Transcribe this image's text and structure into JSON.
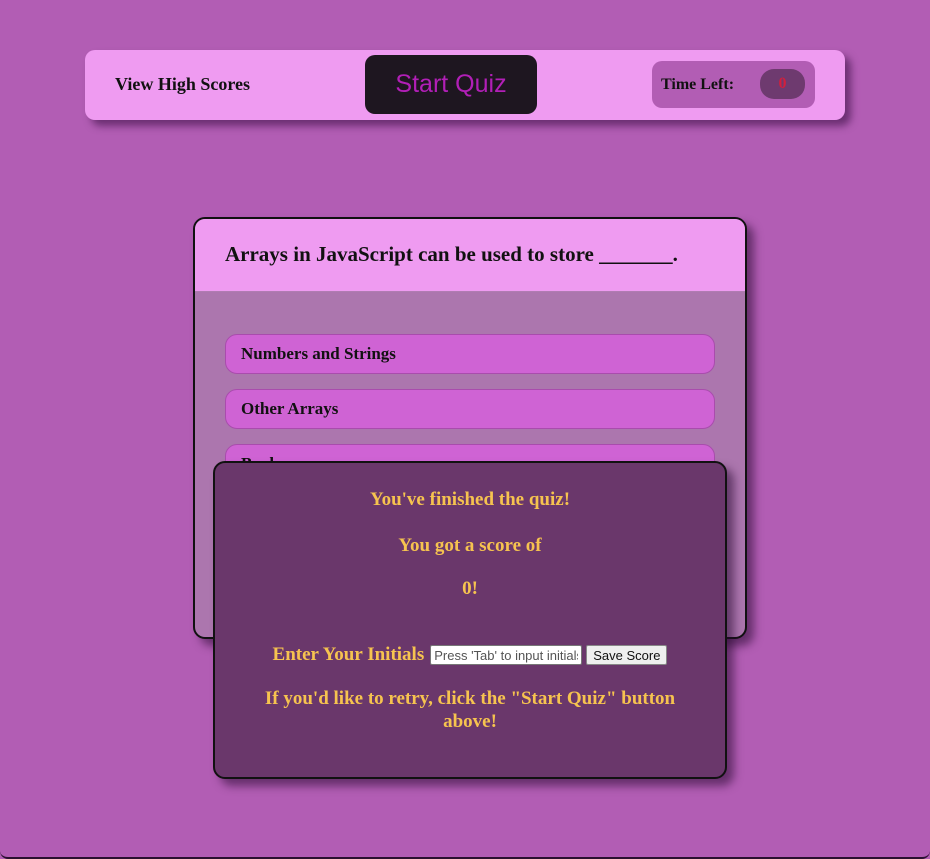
{
  "header": {
    "high_scores_label": "View High Scores",
    "start_label": "Start Quiz",
    "timer_label": "Time Left:",
    "timer_value": "0"
  },
  "question": {
    "text": "Arrays in JavaScript can be used to store _______.",
    "answers": [
      "Numbers and Strings",
      "Other Arrays",
      "Booleans"
    ]
  },
  "results": {
    "finished": "You've finished the quiz!",
    "score_intro": "You got a score of",
    "score_value": "0!",
    "initials_label": "Enter Your Initials",
    "initials_placeholder": "Press 'Tab' to input initials",
    "save_label": "Save Score",
    "retry": "If you'd like to retry, click the \"Start Quiz\" button above!"
  },
  "colors": {
    "background": "#b25db4",
    "header": "#ef9bf1",
    "start_button_bg": "#1e1620",
    "start_button_text": "#b21fb7",
    "timer_text": "#d21f3c",
    "answer": "#cf63d4",
    "results_bg": "#6a376b",
    "results_text": "#f6c34f"
  }
}
